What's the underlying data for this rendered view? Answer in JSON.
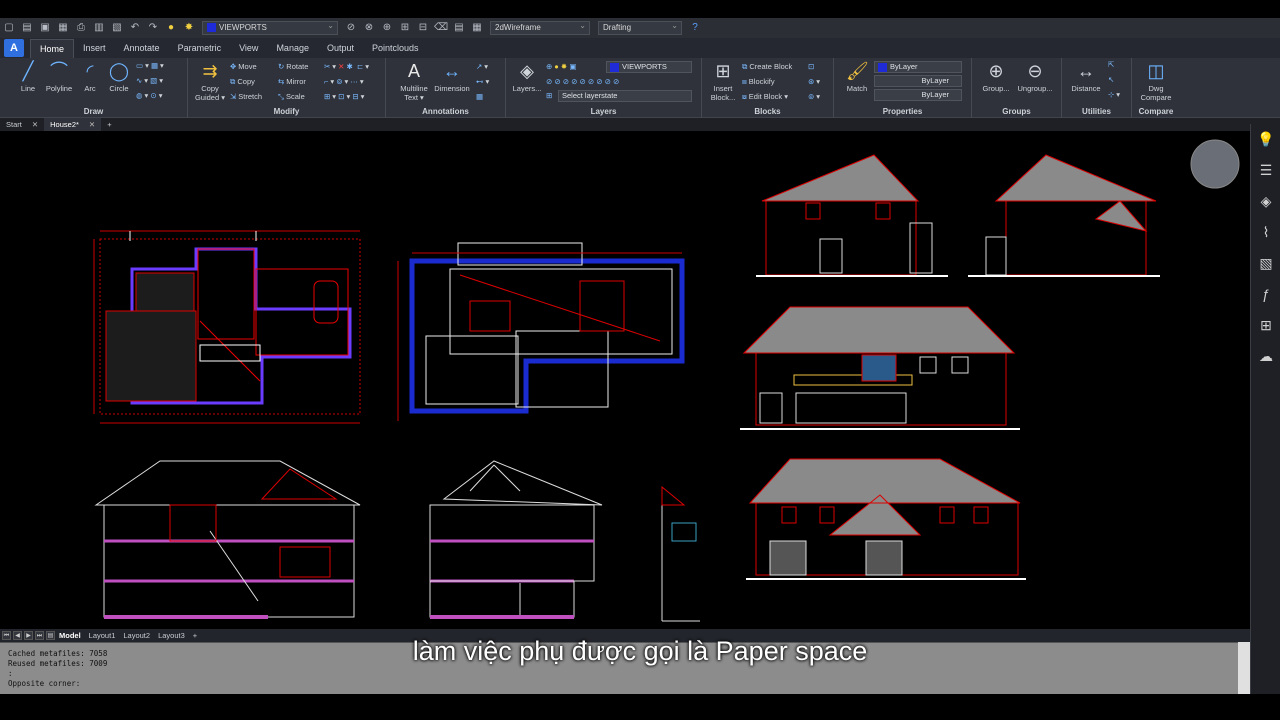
{
  "qat": {
    "viewport_layer": "VIEWPORTS",
    "visual_style": "2dWireframe",
    "workspace": "Drafting"
  },
  "tabs": [
    "Home",
    "Insert",
    "Annotate",
    "Parametric",
    "View",
    "Manage",
    "Output",
    "Pointclouds"
  ],
  "ribbon": {
    "draw": {
      "title": "Draw",
      "line": "Line",
      "polyline": "Polyline",
      "arc": "Arc",
      "circle": "Circle"
    },
    "modify": {
      "title": "Modify",
      "copy_guided": "Copy",
      "copy_guided2": "Guided ▾",
      "move": "Move",
      "copy": "Copy",
      "stretch": "Stretch",
      "rotate": "Rotate",
      "mirror": "Mirror",
      "scale": "Scale"
    },
    "annotations": {
      "title": "Annotations",
      "mtext1": "Multiline",
      "mtext2": "Text ▾",
      "dimension": "Dimension"
    },
    "layers": {
      "title": "Layers",
      "layers_btn": "Layers...",
      "current_layer": "VIEWPORTS",
      "layer_state": "Select layerstate"
    },
    "blocks": {
      "title": "Blocks",
      "insert1": "Insert",
      "insert2": "Block...",
      "create": "Create Block",
      "blockify": "Blockify",
      "edit": "Edit Block ▾"
    },
    "properties": {
      "title": "Properties",
      "match": "Match",
      "color": "ByLayer",
      "linetype": "ByLayer",
      "lineweight": "ByLayer"
    },
    "groups": {
      "title": "Groups",
      "group": "Group...",
      "ungroup": "Ungroup..."
    },
    "utilities": {
      "title": "Utilities",
      "distance": "Distance"
    },
    "compare": {
      "title": "Compare",
      "dwg1": "Dwg",
      "dwg2": "Compare"
    }
  },
  "doc_tabs": [
    "Start",
    "House2*"
  ],
  "layout_tabs": [
    "Model",
    "Layout1",
    "Layout2",
    "Layout3"
  ],
  "command_lines": [
    "Cached metafiles: 7058",
    "Reused metafiles: 7009",
    ":",
    "Opposite corner:"
  ],
  "subtitle": "làm việc phụ được gọi là Paper space"
}
